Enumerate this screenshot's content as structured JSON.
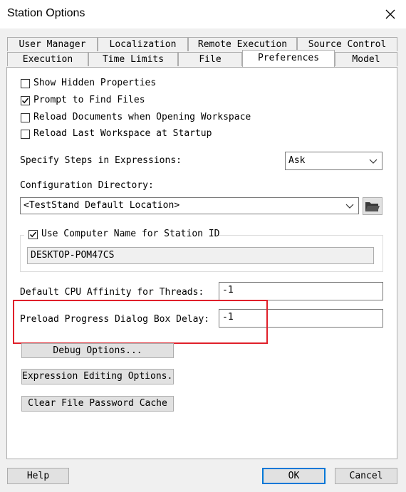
{
  "window": {
    "title": "Station Options"
  },
  "tabs": {
    "row1": [
      "User Manager",
      "Localization",
      "Remote Execution",
      "Source Control"
    ],
    "row2": [
      "Execution",
      "Time Limits",
      "File",
      "Preferences",
      "Model"
    ],
    "active": "Preferences"
  },
  "preferences": {
    "checkboxes": [
      {
        "label": "Show Hidden Properties",
        "checked": false
      },
      {
        "label": "Prompt to Find Files",
        "checked": true
      },
      {
        "label": "Reload Documents when Opening Workspace",
        "checked": false
      },
      {
        "label": "Reload Last Workspace at Startup",
        "checked": false
      }
    ],
    "specify_steps_label": "Specify Steps in Expressions:",
    "specify_steps_value": "Ask",
    "config_dir_label": "Configuration Directory:",
    "config_dir_value": "<TestStand Default Location>",
    "use_computer_name_label": "Use Computer Name for Station ID",
    "use_computer_name_checked": true,
    "station_id_value": "DESKTOP-POM47CS",
    "cpu_affinity_label": "Default CPU Affinity for Threads:",
    "cpu_affinity_value": "-1",
    "preload_delay_label": "Preload Progress Dialog Box Delay:",
    "preload_delay_value": "-1",
    "debug_options_label": "Debug Options...",
    "expression_editing_label": "Expression Editing Options...",
    "clear_password_label": "Clear File Password Cache"
  },
  "footer": {
    "help_label": "Help",
    "ok_label": "OK",
    "cancel_label": "Cancel"
  },
  "colors": {
    "highlight": "#e0202a",
    "default_button_border": "#0078d7"
  }
}
